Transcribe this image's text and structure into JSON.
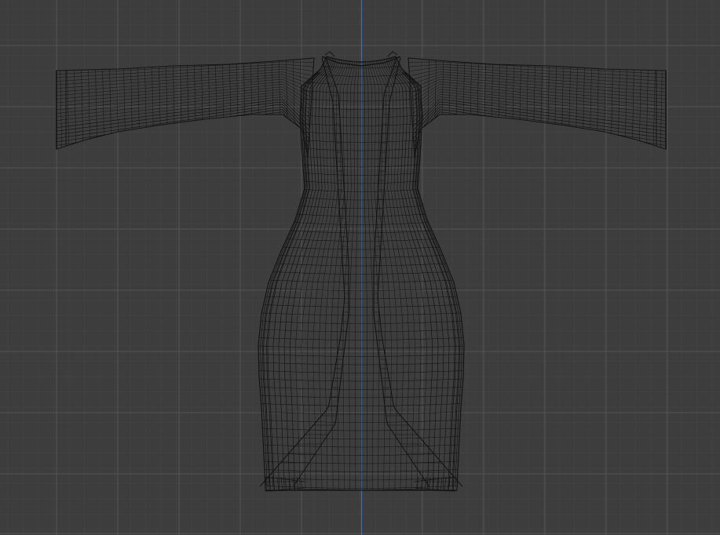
{
  "viewport": {
    "view": "front-orthographic",
    "shading": "wireframe",
    "object": "dress",
    "colors": {
      "background": "#3d3d3d",
      "grid_minor": "#434343",
      "grid_major": "#545454",
      "axis_z": "#3f6ebf",
      "wire": "#141414"
    }
  }
}
